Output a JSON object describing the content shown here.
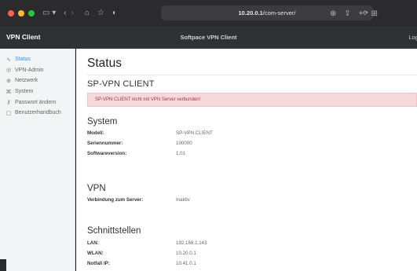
{
  "browser": {
    "nav_icons": [
      "‹",
      "›"
    ],
    "url_host": "10.20.0.1",
    "url_path": "/com-server/",
    "colors": {
      "close": "#ff5f57",
      "minimize": "#febc2e",
      "maximize": "#28c840"
    }
  },
  "header": {
    "brand": "VPN Client",
    "title": "Softpace VPN Client",
    "logo": "Logo"
  },
  "sidebar": {
    "items": [
      {
        "label": "Status",
        "icon": "pulse-icon"
      },
      {
        "label": "VPN-Admin",
        "icon": "settings-icon"
      },
      {
        "label": "Netzwerk",
        "icon": "globe-icon"
      },
      {
        "label": "System",
        "icon": "system-icon"
      },
      {
        "label": "Passwort ändern",
        "icon": "key-icon"
      },
      {
        "label": "Benutzerhandbuch",
        "icon": "book-icon"
      }
    ]
  },
  "main": {
    "title": "Status",
    "client_heading": "SP-VPN CLIENT",
    "alert": "SP-VPN CLIENT nicht mit VPN Server verbunden!",
    "system": {
      "heading": "System",
      "rows": [
        {
          "key": "Modell:",
          "value": "SP-VPN CLIENT"
        },
        {
          "key": "Seriennummer:",
          "value": "100000"
        },
        {
          "key": "Softwareversion:",
          "value": "1.01"
        }
      ]
    },
    "vpn": {
      "heading": "VPN",
      "rows": [
        {
          "key": "Verbindung zum Server:",
          "value": "Inaktiv"
        }
      ]
    },
    "interfaces": {
      "heading": "Schnittstellen",
      "rows": [
        {
          "key": "LAN:",
          "value": "192.168.1.143"
        },
        {
          "key": "WLAN:",
          "value": "10.20.0.1"
        },
        {
          "key": "Notfall IP:",
          "value": "10.41.0.1"
        }
      ]
    }
  }
}
